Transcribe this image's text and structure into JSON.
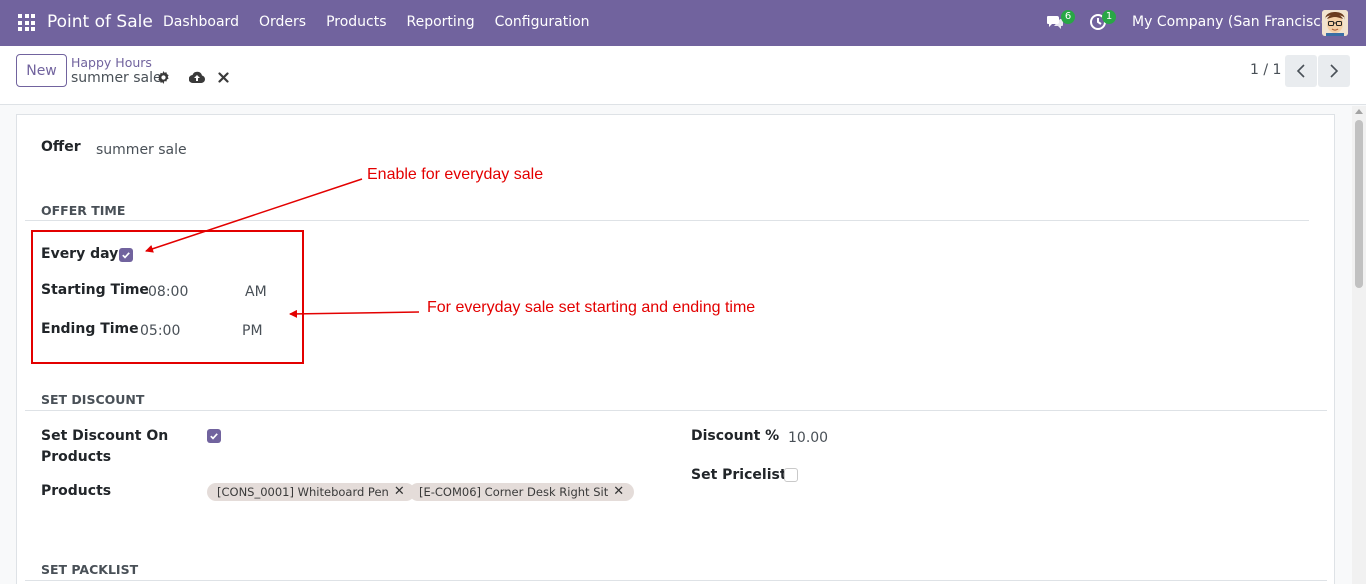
{
  "navbar": {
    "brand": "Point of Sale",
    "menu": [
      {
        "label": "Dashboard"
      },
      {
        "label": "Orders"
      },
      {
        "label": "Products"
      },
      {
        "label": "Reporting"
      },
      {
        "label": "Configuration"
      }
    ],
    "messages_count": "6",
    "activities_count": "1",
    "company": "My Company (San Francisco)",
    "accent_color": "#71639e"
  },
  "control_panel": {
    "new_label": "New",
    "breadcrumb_parent": "Happy Hours",
    "breadcrumb_current": "summer sale",
    "pager_value": "1 / 1"
  },
  "form": {
    "offer_label": "Offer",
    "offer_value": "summer sale",
    "offer_time_title": "OFFER TIME",
    "every_day_label": "Every day",
    "every_day_checked": true,
    "starting_time_label": "Starting Time",
    "starting_time_value": "08:00",
    "starting_time_period": "AM",
    "ending_time_label": "Ending Time",
    "ending_time_value": "05:00",
    "ending_time_period": "PM",
    "set_discount_title": "SET DISCOUNT",
    "set_discount_on_label_1": "Set Discount On",
    "set_discount_on_label_2": "Products",
    "set_discount_on_checked": true,
    "products_label": "Products",
    "products": [
      {
        "name": "[CONS_0001] Whiteboard Pen"
      },
      {
        "name": "[E-COM06] Corner Desk Right Sit"
      }
    ],
    "discount_label": "Discount %",
    "discount_value": "10.00",
    "set_pricelist_label": "Set Pricelist",
    "set_pricelist_checked": false,
    "set_packlist_title": "SET PACKLIST"
  },
  "annotations": {
    "everyday": "Enable for everyday sale",
    "times": "For everyday sale set starting and ending time",
    "color": "#e30000"
  }
}
